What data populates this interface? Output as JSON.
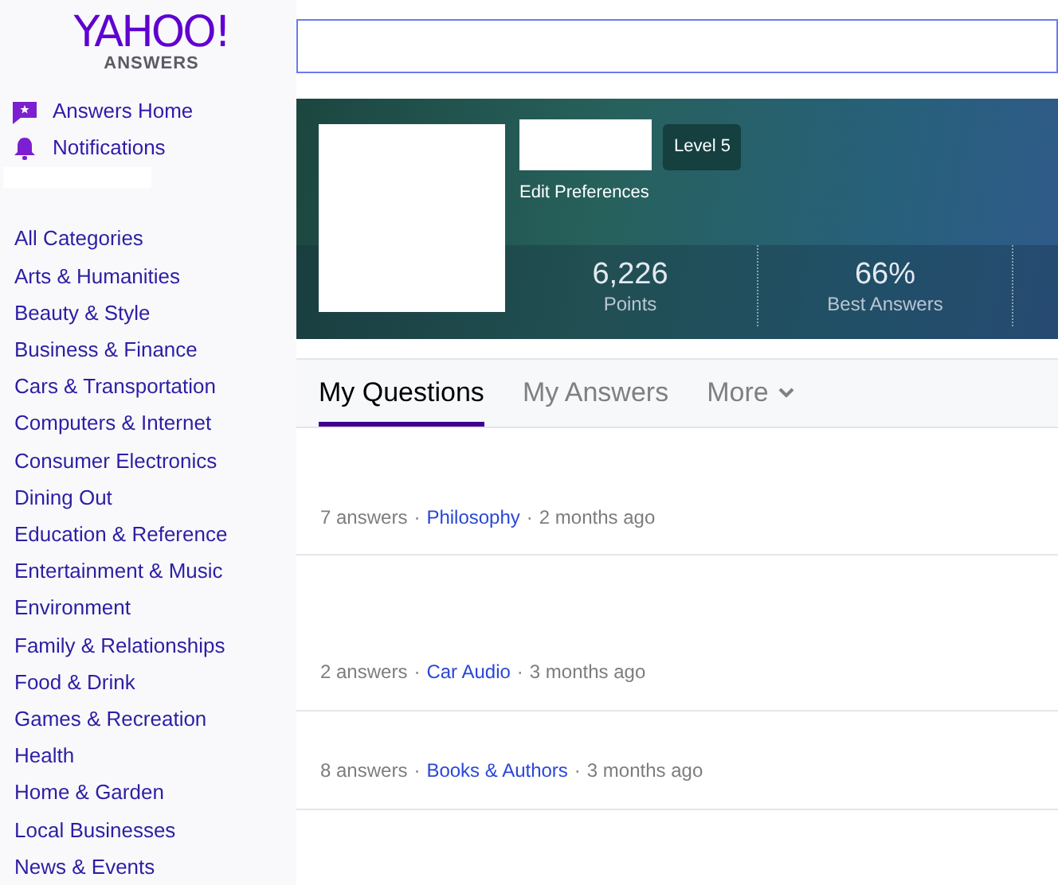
{
  "logo": {
    "brand": "YAHOO!",
    "product": "ANSWERS"
  },
  "nav": [
    {
      "kind": "home",
      "label": "Answers Home"
    },
    {
      "kind": "bell",
      "label": "Notifications"
    }
  ],
  "categories": [
    "All Categories",
    "Arts & Humanities",
    "Beauty & Style",
    "Business & Finance",
    "Cars & Transportation",
    "Computers & Internet",
    "Consumer Electronics",
    "Dining Out",
    "Education & Reference",
    "Entertainment & Music",
    "Environment",
    "Family & Relationships",
    "Food & Drink",
    "Games & Recreation",
    "Health",
    "Home & Garden",
    "Local Businesses",
    "News & Events"
  ],
  "profile": {
    "edit_link": "Edit Preferences",
    "level": "Level 5",
    "stats": [
      {
        "value": "6,226",
        "label": "Points"
      },
      {
        "value": "66%",
        "label": "Best Answers"
      }
    ]
  },
  "tabs": [
    {
      "label": "My Questions",
      "selected": true,
      "dropdown": false
    },
    {
      "label": "My Answers",
      "selected": false,
      "dropdown": false
    },
    {
      "label": "More",
      "selected": false,
      "dropdown": true
    }
  ],
  "questions": [
    {
      "answers": "7 answers",
      "sep1": "·",
      "category": "Philosophy",
      "sep2": "·",
      "time": "2 months ago"
    },
    {
      "answers": "2 answers",
      "sep1": "·",
      "category": "Car Audio",
      "sep2": "·",
      "time": "3 months ago"
    },
    {
      "answers": "8 answers",
      "sep1": "·",
      "category": "Books & Authors",
      "sep2": "·",
      "time": "3 months ago"
    }
  ]
}
